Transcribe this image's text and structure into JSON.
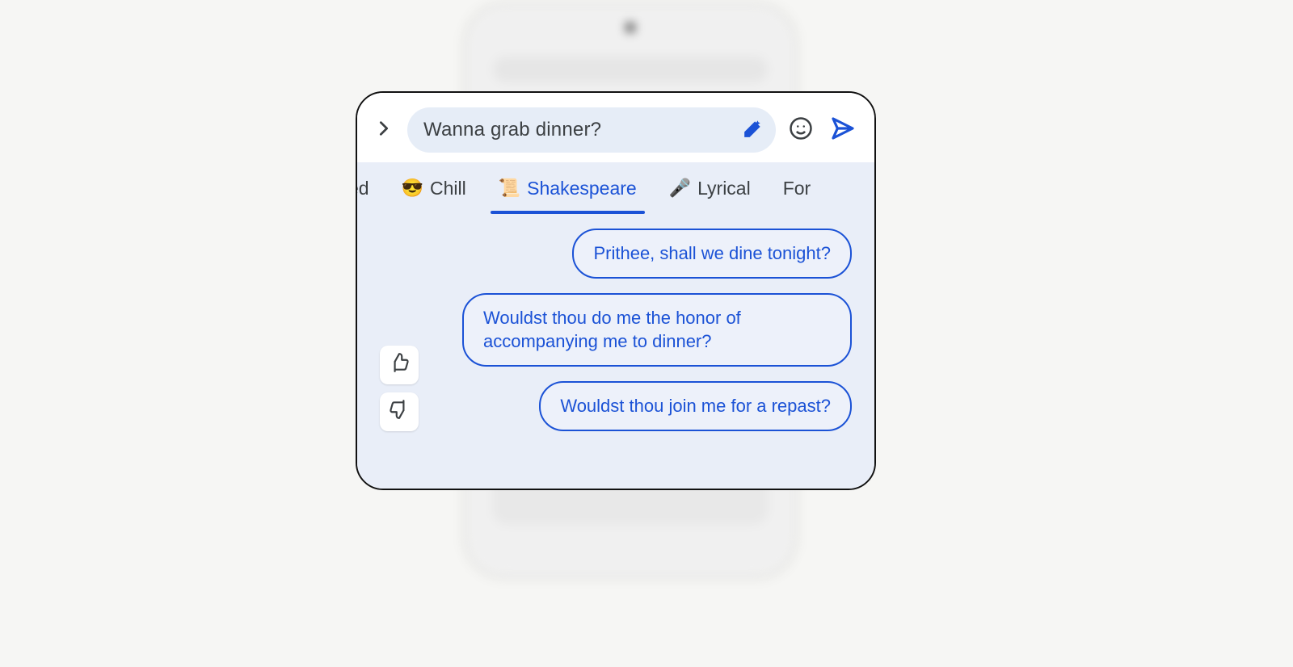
{
  "compose": {
    "text": "Wanna grab dinner?"
  },
  "tabs": [
    {
      "emoji": "",
      "label": "cited",
      "active": false,
      "cut": "left"
    },
    {
      "emoji": "😎",
      "label": "Chill",
      "active": false
    },
    {
      "emoji": "📜",
      "label": "Shakespeare",
      "active": true
    },
    {
      "emoji": "🎤",
      "label": "Lyrical",
      "active": false
    },
    {
      "emoji": "",
      "label": "For",
      "active": false,
      "cut": "right"
    }
  ],
  "suggestions": [
    "Prithee, shall we dine tonight?",
    "Wouldst thou do me the honor of accompanying me to dinner?",
    "Wouldst thou join me for a repast?"
  ],
  "colors": {
    "accent": "#1b52d6",
    "panel": "#e9eef8",
    "pill": "#e6edf7",
    "text": "#3c4043"
  }
}
